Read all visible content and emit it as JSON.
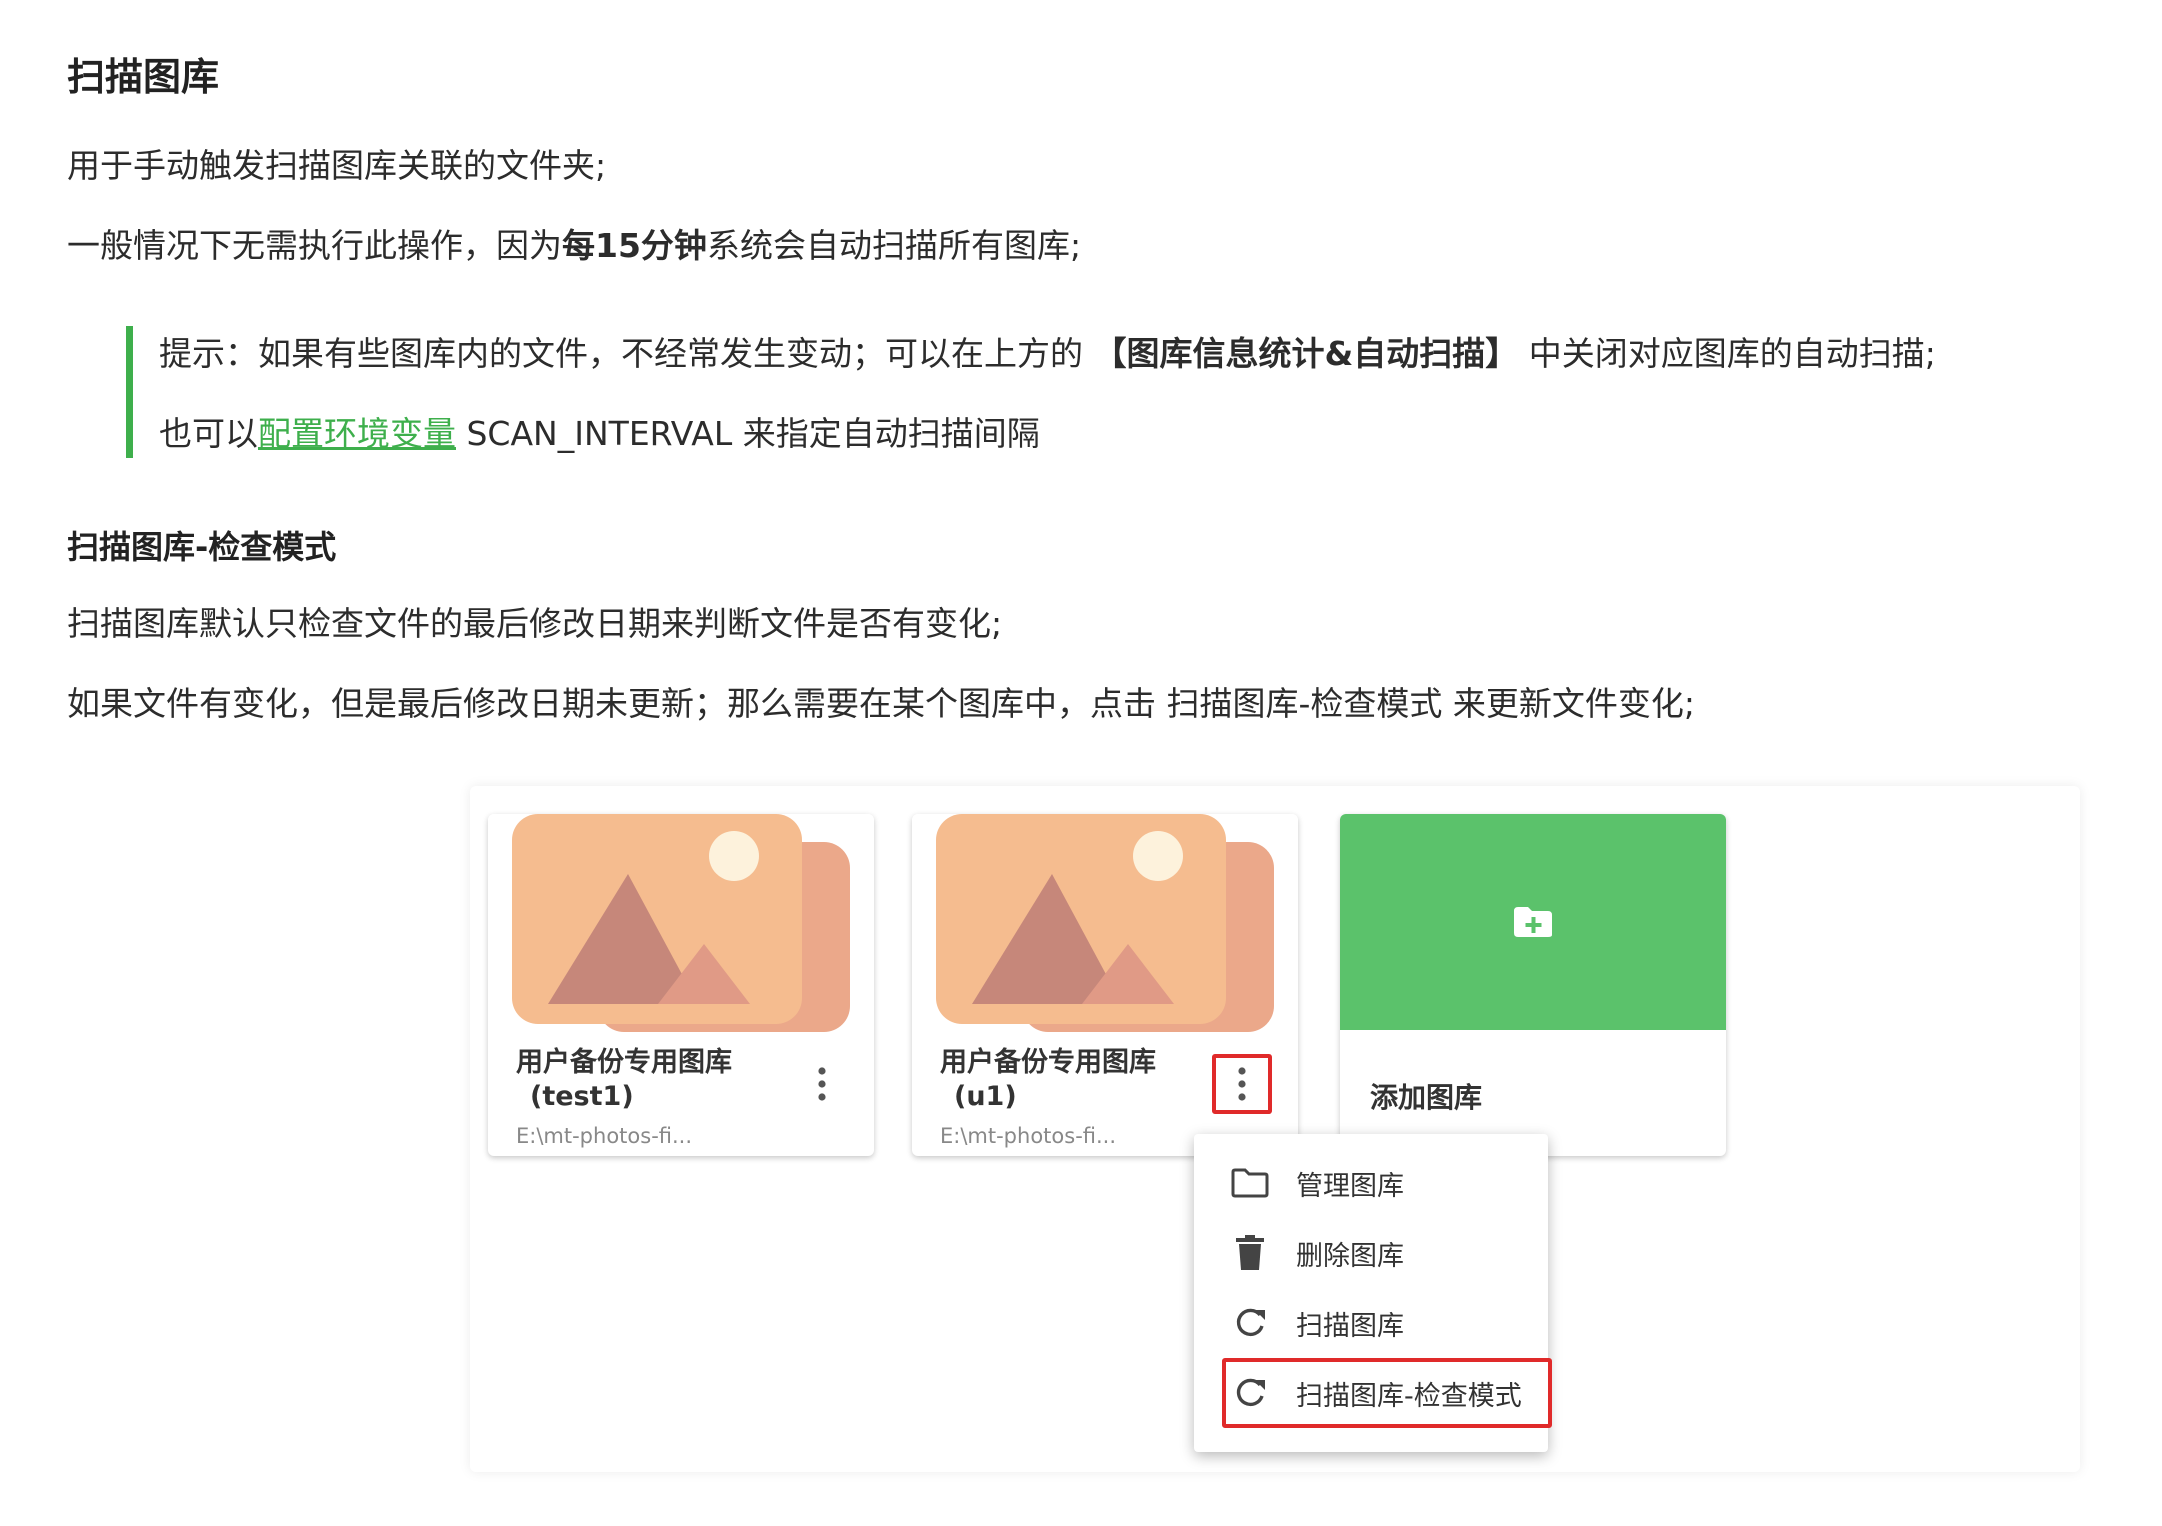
{
  "section_title": "扫描图库",
  "intro": "用于手动触发扫描图库关联的文件夹;",
  "auto_scan": {
    "before": "一般情况下无需执行此操作，因为",
    "bold": "每15分钟",
    "after": "系统会自动扫描所有图库;"
  },
  "tip": {
    "line1_before": "提示：如果有些图库内的文件，不经常发生变动；可以在上方的 ",
    "line1_bold": "【图库信息统计&自动扫描】",
    "line1_after": " 中关闭对应图库的自动扫描;",
    "line2_before": "也可以",
    "line2_link": "配置环境变量",
    "line2_after": " SCAN_INTERVAL 来指定自动扫描间隔"
  },
  "subsection_title": "扫描图库-检查模式",
  "check_desc": "扫描图库默认只检查文件的最后修改日期来判断文件是否有变化;",
  "check_how": "如果文件有变化，但是最后修改日期未更新；那么需要在某个图库中，点击 扫描图库-检查模式 来更新文件变化;",
  "galleries": [
    {
      "name_line1": "用户备份专用图库",
      "name_line2": "(test1)",
      "path": "E:\\mt-photos-fi..."
    },
    {
      "name_line1": "用户备份专用图库",
      "name_line2": "(u1)",
      "path": "E:\\mt-photos-fi..."
    }
  ],
  "add_gallery_label": "添加图库",
  "menu": {
    "items": [
      "管理图库",
      "删除图库",
      "扫描图库",
      "扫描图库-检查模式"
    ],
    "icons": [
      "folder-icon",
      "trash-icon",
      "refresh-icon",
      "refresh-icon"
    ]
  },
  "colors": {
    "accent_green": "#3eaf4c",
    "add_card_green": "#5bc26b",
    "highlight_red": "#e02a2a",
    "thumb_peach": "#f5bc8f"
  }
}
